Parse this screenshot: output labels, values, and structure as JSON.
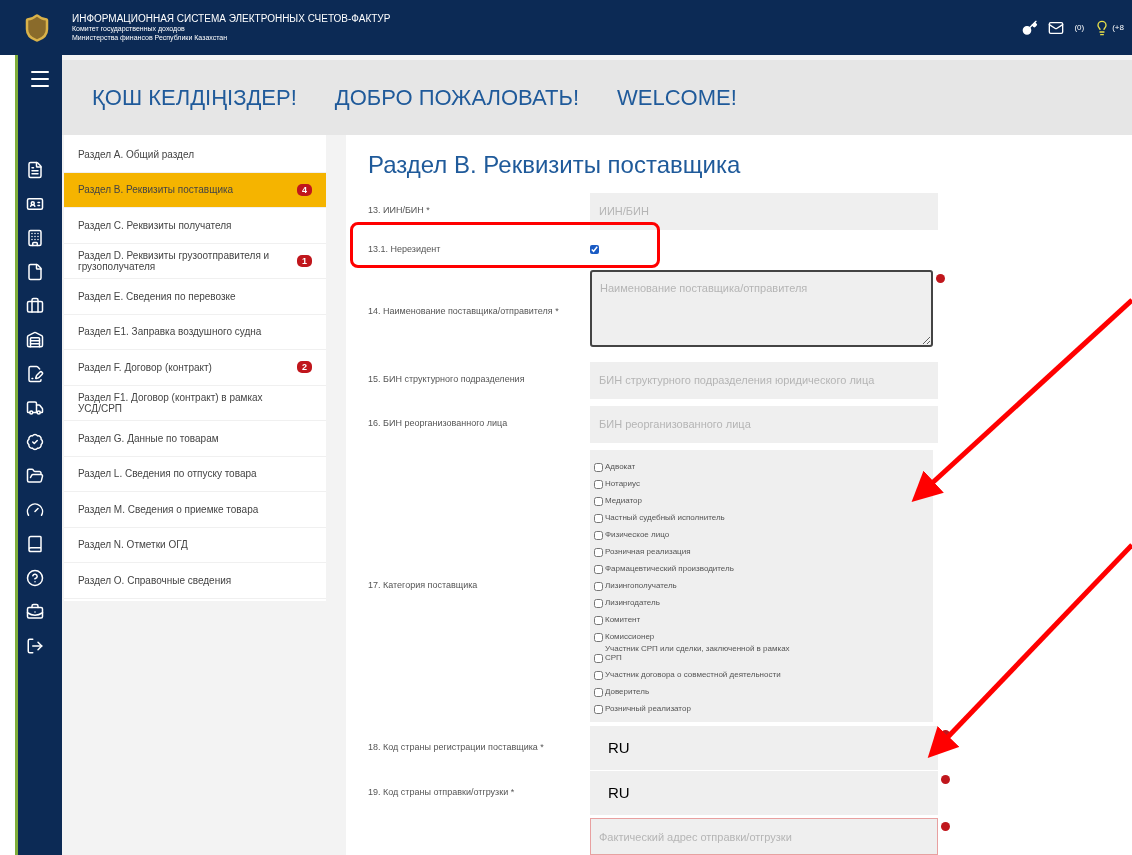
{
  "header": {
    "title": "ИНФОРМАЦИОННАЯ СИСТЕМА ЭЛЕКТРОННЫХ СЧЕТОВ-ФАКТУР",
    "subtitle_1": "Комитет государственных доходов",
    "subtitle_2": "Министерства финансов Республики Казахстан",
    "mail_count": "(0)",
    "notice_count": "(+8"
  },
  "welcome": [
    "ҚОШ КЕЛДІҢІЗДЕР!",
    "ДОБРО ПОЖАЛОВАТЬ!",
    "WELCOME!"
  ],
  "sections": [
    {
      "label": "Раздел A. Общий раздел",
      "selected": false
    },
    {
      "label": "Раздел B. Реквизиты поставщика",
      "selected": true,
      "badge": "4"
    },
    {
      "label": "Раздел C. Реквизиты получателя",
      "selected": false
    },
    {
      "label": "Раздел D. Реквизиты грузоотправителя и грузополучателя",
      "selected": false,
      "badge": "1"
    },
    {
      "label": "Раздел E. Сведения по перевозке",
      "selected": false
    },
    {
      "label": "Раздел E1. Заправка воздушного судна",
      "selected": false
    },
    {
      "label": "Раздел F. Договор (контракт)",
      "selected": false,
      "badge": "2"
    },
    {
      "label": "Раздел F1. Договор (контракт) в рамках УСД/СРП",
      "selected": false
    },
    {
      "label": "Раздел G. Данные по товарам",
      "selected": false
    },
    {
      "label": "Раздел L. Сведения по отпуску товара",
      "selected": false
    },
    {
      "label": "Раздел M. Сведения о приемке товара",
      "selected": false
    },
    {
      "label": "Раздел N. Отметки ОГД",
      "selected": false
    },
    {
      "label": "Раздел O. Справочные сведения",
      "selected": false
    }
  ],
  "form": {
    "title": "Раздел B. Реквизиты поставщика",
    "fields": [
      {
        "kind": "text",
        "label": "13. ИИН/БИН *",
        "placeholder": "ИИН/БИН",
        "error": false
      },
      {
        "kind": "checkbox",
        "label": "13.1. Нерезидент",
        "checked": true
      },
      {
        "kind": "textarea",
        "label": "14. Наименование поставщика/отправителя *",
        "placeholder": "Наименование поставщика/отправителя",
        "error": true
      },
      {
        "kind": "text",
        "label": "15. БИН структурного подразделения",
        "placeholder": "БИН структурного подразделения юридического лица",
        "error": false
      },
      {
        "kind": "text",
        "label": "16. БИН реорганизованного лица",
        "placeholder": "БИН реорганизованного лица",
        "error": false
      },
      {
        "kind": "group",
        "label": "17. Категория поставщика",
        "options": [
          {
            "label": "Адвокат",
            "checked": false
          },
          {
            "label": "Нотариус",
            "checked": false
          },
          {
            "label": "Медиатор",
            "checked": false
          },
          {
            "label": "Частный судебный исполнитель",
            "checked": false
          },
          {
            "label": "Физическое лицо",
            "checked": false
          },
          {
            "label": "Розничная реализация",
            "checked": false
          },
          {
            "label": "Фармацевтический производитель",
            "checked": false
          },
          {
            "label": "Лизингополучатель",
            "checked": false
          },
          {
            "label": "Лизингодатель",
            "checked": false
          },
          {
            "label": "Комитент",
            "checked": false
          },
          {
            "label": "Комиссионер",
            "checked": false
          },
          {
            "label": "Участник СРП или сделки, заключенной в рамках СРП",
            "checked": false
          },
          {
            "label": "Участник договора о совместной деятельности",
            "checked": false
          },
          {
            "label": "Доверитель",
            "checked": false
          },
          {
            "label": "Розничный реализатор",
            "checked": false
          }
        ]
      },
      {
        "kind": "text",
        "label": "18. Код страны регистрации поставщика *",
        "value": "RU",
        "error": true
      },
      {
        "kind": "text",
        "label": "19. Код страны отправки/отгрузки *",
        "value": "RU",
        "error": true
      },
      {
        "kind": "text",
        "placeholder": "Фактический адрес отправки/отгрузки",
        "error": true
      }
    ]
  }
}
